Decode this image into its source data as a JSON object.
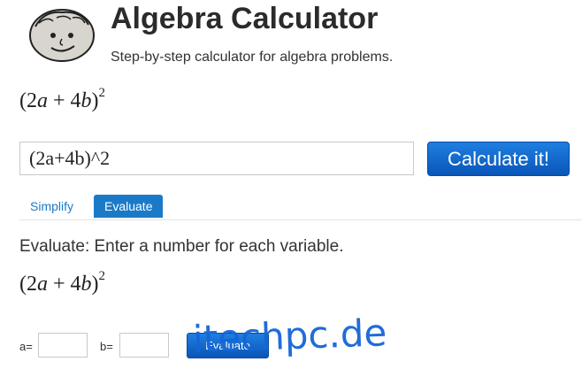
{
  "header": {
    "title": "Algebra Calculator",
    "subtitle": "Step-by-step calculator for algebra problems."
  },
  "expression": {
    "open": "(2",
    "var_a": "a",
    "plus": " + 4",
    "var_b": "b",
    "close": ")",
    "exponent": "2"
  },
  "input": {
    "value": "(2a+4b)^2"
  },
  "calculate_button": "Calculate it!",
  "tabs": [
    {
      "label": "Simplify",
      "active": false
    },
    {
      "label": "Evaluate",
      "active": true
    }
  ],
  "evaluate": {
    "instruction": "Evaluate: Enter a number for each variable.",
    "vars": [
      {
        "label": "a=",
        "value": ""
      },
      {
        "label": "b=",
        "value": ""
      }
    ],
    "button": "Evaluate"
  },
  "watermark": "itechpc.de",
  "colors": {
    "accent": "#1a7ac8",
    "button": "#0a55b8"
  }
}
